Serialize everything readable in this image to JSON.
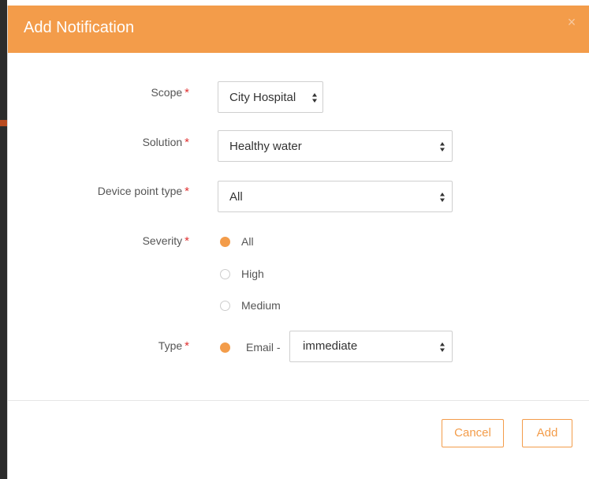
{
  "modal": {
    "title": "Add Notification",
    "close_glyph": "×"
  },
  "form": {
    "required_mark": "*",
    "scope": {
      "label": "Scope",
      "value": "City Hospital"
    },
    "solution": {
      "label": "Solution",
      "value": "Healthy water"
    },
    "device_point_type": {
      "label": "Device point type",
      "value": "All"
    },
    "severity": {
      "label": "Severity",
      "options": [
        {
          "label": "All",
          "checked": true
        },
        {
          "label": "High",
          "checked": false
        },
        {
          "label": "Medium",
          "checked": false
        }
      ]
    },
    "type": {
      "label": "Type",
      "option_label": "Email -",
      "checked": true,
      "frequency_value": "immediate"
    }
  },
  "footer": {
    "cancel_label": "Cancel",
    "add_label": "Add"
  },
  "icons": {
    "close": "close-icon",
    "select_arrows": "sort-arrows-icon",
    "radio": "radio-icon"
  },
  "colors": {
    "accent": "#f39c4a",
    "required": "#e03232",
    "text": "#555555"
  }
}
